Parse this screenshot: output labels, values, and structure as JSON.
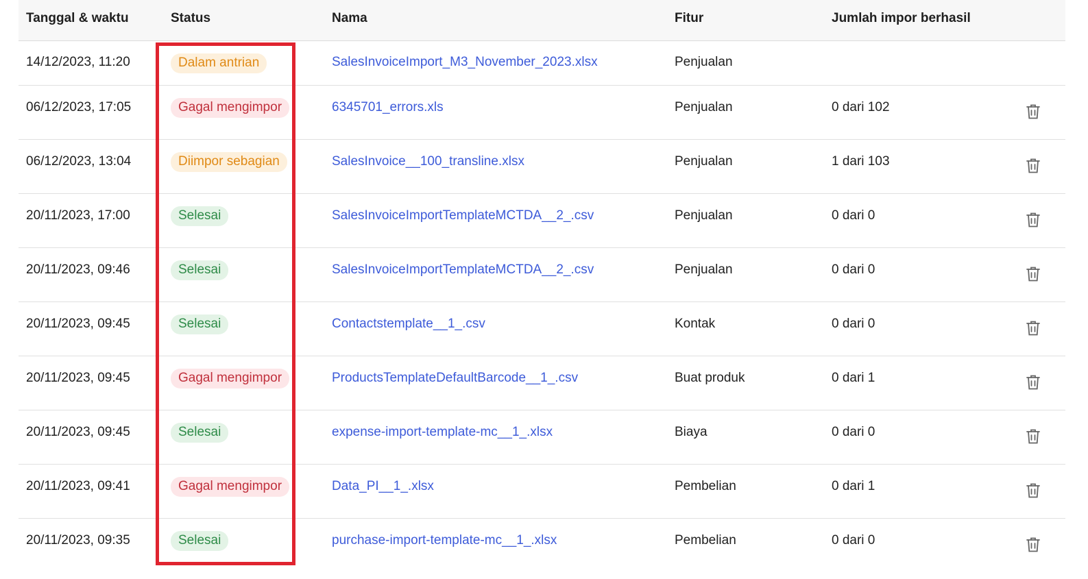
{
  "table": {
    "headers": {
      "date": "Tanggal & waktu",
      "status": "Status",
      "name": "Nama",
      "feature": "Fitur",
      "count": "Jumlah impor berhasil"
    },
    "rows": [
      {
        "date": "14/12/2023, 11:20",
        "status": "Dalam antrian",
        "status_kind": "queued",
        "name": "SalesInvoiceImport_M3_November_2023.xlsx",
        "feature": "Penjualan",
        "count": ""
      },
      {
        "date": "06/12/2023, 17:05",
        "status": "Gagal mengimpor",
        "status_kind": "failed",
        "name": "6345701_errors.xls",
        "feature": "Penjualan",
        "count": "0 dari 102"
      },
      {
        "date": "06/12/2023, 13:04",
        "status": "Diimpor sebagian",
        "status_kind": "partial",
        "name": "SalesInvoice__100_transline.xlsx",
        "feature": "Penjualan",
        "count": "1 dari 103"
      },
      {
        "date": "20/11/2023, 17:00",
        "status": "Selesai",
        "status_kind": "done",
        "name": "SalesInvoiceImportTemplateMCTDA__2_.csv",
        "feature": "Penjualan",
        "count": "0 dari 0"
      },
      {
        "date": "20/11/2023, 09:46",
        "status": "Selesai",
        "status_kind": "done",
        "name": "SalesInvoiceImportTemplateMCTDA__2_.csv",
        "feature": "Penjualan",
        "count": "0 dari 0"
      },
      {
        "date": "20/11/2023, 09:45",
        "status": "Selesai",
        "status_kind": "done",
        "name": "Contactstemplate__1_.csv",
        "feature": "Kontak",
        "count": "0 dari 0"
      },
      {
        "date": "20/11/2023, 09:45",
        "status": "Gagal mengimpor",
        "status_kind": "failed",
        "name": "ProductsTemplateDefaultBarcode__1_.csv",
        "feature": "Buat produk",
        "count": "0 dari 1"
      },
      {
        "date": "20/11/2023, 09:45",
        "status": "Selesai",
        "status_kind": "done",
        "name": "expense-import-template-mc__1_.xlsx",
        "feature": "Biaya",
        "count": "0 dari 0"
      },
      {
        "date": "20/11/2023, 09:41",
        "status": "Gagal mengimpor",
        "status_kind": "failed",
        "name": "Data_PI__1_.xlsx",
        "feature": "Pembelian",
        "count": "0 dari 1"
      },
      {
        "date": "20/11/2023, 09:35",
        "status": "Selesai",
        "status_kind": "done",
        "name": "purchase-import-template-mc__1_.xlsx",
        "feature": "Pembelian",
        "count": "0 dari 0"
      }
    ]
  },
  "icons": {
    "delete": "trash-icon"
  },
  "colors": {
    "link": "#3d5bd9",
    "highlight": "#e0242f",
    "queued": "#e08a16",
    "failed": "#c0303c",
    "done": "#2e8b48"
  }
}
